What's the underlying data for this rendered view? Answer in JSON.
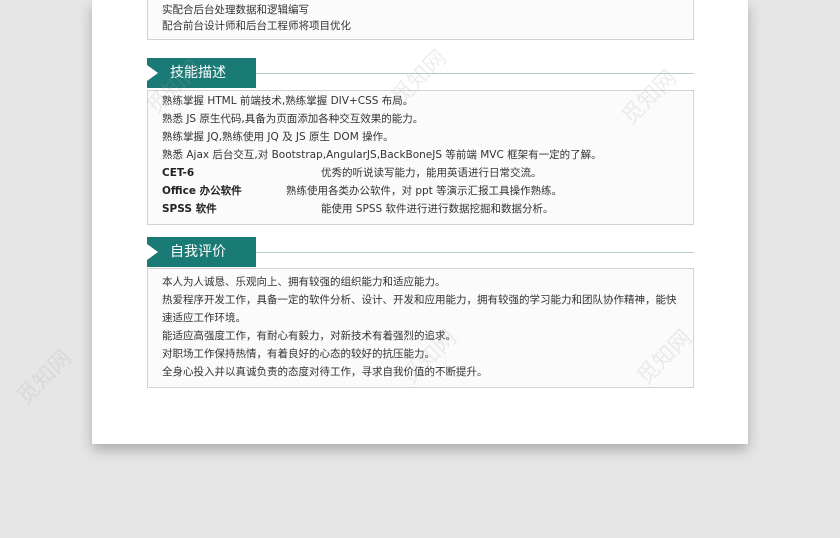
{
  "watermark": "觅知网",
  "top_section": {
    "lines": [
      "实配合后台处理数据和逻辑编写",
      "配合前台设计师和后台工程师将项目优化"
    ]
  },
  "skills": {
    "heading": "技能描述",
    "lines": [
      "熟练掌握 HTML 前端技术,熟练掌握 DIV+CSS 布局。",
      "熟悉 JS 原生代码,具备为页面添加各种交互效果的能力。",
      "熟练掌握 JQ,熟练使用 JQ 及 JS 原生 DOM 操作。",
      "熟悉 Ajax 后台交互,对 Bootstrap,AngularJS,BackBoneJS 等前端 MVC 框架有一定的了解。"
    ],
    "items": [
      {
        "name": "CET-6",
        "desc": "优秀的听说读写能力，能用英语进行日常交流。"
      },
      {
        "name": "Office 办公软件",
        "desc": "熟练使用各类办公软件，对 ppt 等演示汇报工具操作熟练。"
      },
      {
        "name": "SPSS 软件",
        "desc": "能使用 SPSS 软件进行进行数据挖掘和数据分析。"
      }
    ]
  },
  "evaluation": {
    "heading": "自我评价",
    "lines": [
      "本人为人诚恳、乐观向上、拥有较强的组织能力和适应能力。",
      "热爱程序开发工作，具备一定的软件分析、设计、开发和应用能力，拥有较强的学习能力和团队协作精神，能快",
      "速适应工作环境。",
      "能适应高强度工作，有耐心有毅力，对新技术有着强烈的追求。",
      "对职场工作保持热情，有着良好的心态的较好的抗压能力。",
      "全身心投入并以真诚负责的态度对待工作，寻求自我价值的不断提升。"
    ]
  },
  "colors": {
    "accent": "#1a7b76",
    "page_background": "#e6e6e6"
  }
}
